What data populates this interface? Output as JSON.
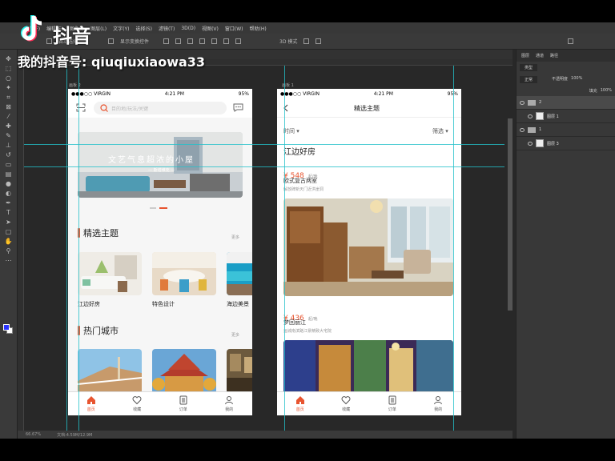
{
  "menubar": {
    "items": [
      "文件(F)",
      "编辑(E)",
      "图像(I)",
      "图层(L)",
      "文字(Y)",
      "选择(S)",
      "滤镜(T)",
      "3D(D)",
      "视图(V)",
      "窗口(W)",
      "帮助(H)"
    ]
  },
  "optionsbar": {
    "auto_select": "自动选择",
    "show_transform": "显示变换控件",
    "mode3d": "3D 模式"
  },
  "artboards": {
    "left": "画板 2",
    "right": "画板 1"
  },
  "statusbar": {
    "zoom": "66.67%",
    "doc": "文档:4.59M/12.9M"
  },
  "layers_panel": {
    "tabs": [
      "图层",
      "通道",
      "路径"
    ],
    "filter": "类型",
    "mode": "正常",
    "opacity_label": "不透明度",
    "opacity": "100%",
    "fill_label": "填充",
    "fill": "100%",
    "rows": [
      "2",
      "图层 1",
      "1",
      "图层 3"
    ]
  },
  "status_bar_phone": {
    "carrier": "●●●○○ VIRGIN",
    "time": "4:21 PM",
    "battery": "95%"
  },
  "phone_left": {
    "search_placeholder": "目的地/玩法/关键",
    "banner_title": "文艺气息超浓的小屋",
    "banner_sub": "— 斯塔维克 —",
    "section1": "精选主题",
    "section2": "热门城市",
    "more": "更多",
    "cards": [
      "江边好房",
      "特色设计",
      "海边美景"
    ]
  },
  "phone_right": {
    "title": "精选主题",
    "filter_time": "时间 ▾",
    "filter_select": "筛选 ▾",
    "heading": "江边好房",
    "listing1": {
      "price": "¥ 548",
      "unit": "起/晚",
      "name": "欧式复古两室",
      "addr": "解放碑新天门近洪崖洞"
    },
    "listing2": {
      "price": "¥ 436",
      "unit": "起/晚",
      "name": "梦回丽江",
      "addr": "运城南滨路江景精致大宅院"
    }
  },
  "tabbar": {
    "home": "首页",
    "fav": "收藏",
    "order": "订单",
    "mine": "我的"
  },
  "watermark": {
    "brand": "抖音",
    "account": "我的抖音号: qiuqiuxiaowa33"
  },
  "colors": {
    "accent": "#e8542f",
    "guide": "#23c1c9",
    "ps_bg": "#282828"
  }
}
